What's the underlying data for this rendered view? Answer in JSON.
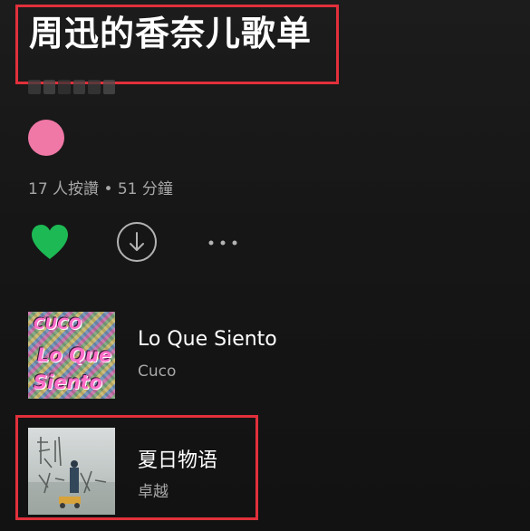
{
  "playlist": {
    "title": "周迅的香奈儿歌单",
    "meta": "17 人按讚 • 51 分鐘"
  },
  "colors": {
    "background": "#121212",
    "highlight_box": "#e1303b",
    "heart": "#1db954",
    "avatar": "#f078a6",
    "secondary_text": "#a7a7a7"
  },
  "icons": {
    "like": "heart-icon",
    "download": "download-icon",
    "more": "more-icon"
  },
  "tracks": [
    {
      "title": "Lo Que Siento",
      "artist": "Cuco",
      "cover": {
        "lines": [
          "CUCO",
          "Lo Que",
          "Siento"
        ]
      }
    },
    {
      "title": "夏日物语",
      "artist": "卓越",
      "cover": {}
    }
  ]
}
